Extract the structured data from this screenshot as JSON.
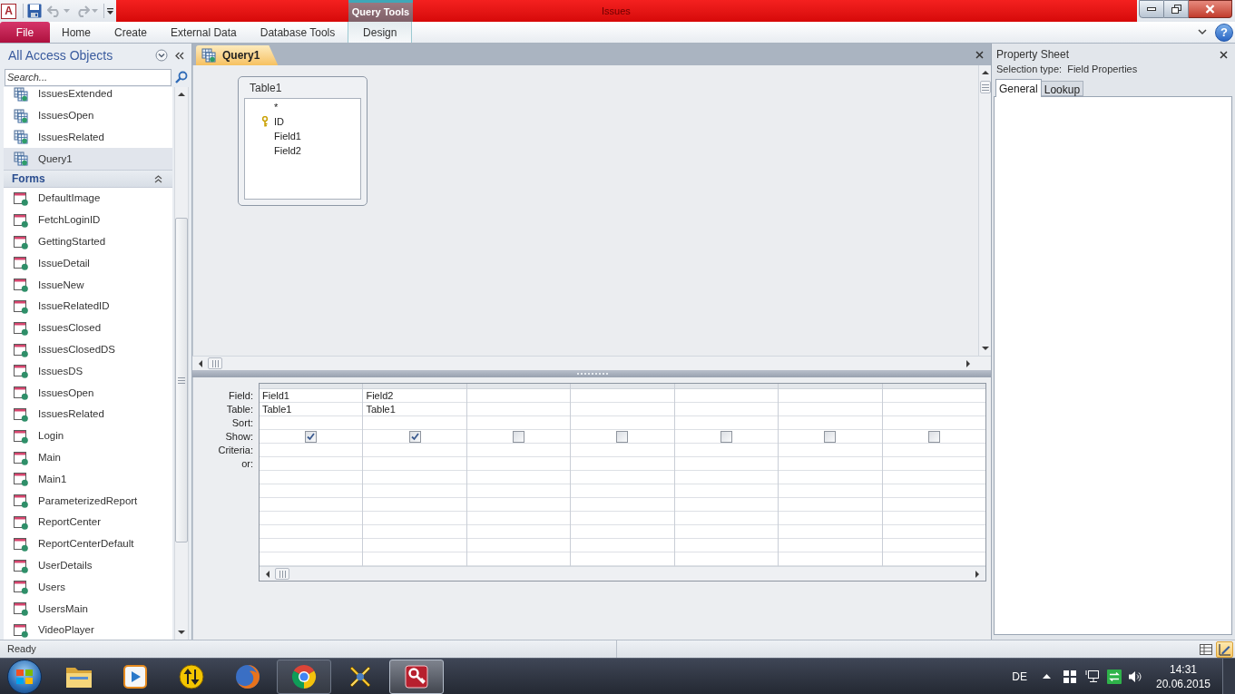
{
  "title_bar": {
    "app_logo": "A",
    "quick_access": [
      {
        "kind": "button",
        "disabled": false
      },
      {
        "kind": "split",
        "disabled": true
      },
      {
        "kind": "split",
        "disabled": true
      }
    ],
    "contextual_group": "Query Tools",
    "title": "Issues"
  },
  "ribbon": {
    "tabs": [
      {
        "label": "File",
        "kind": "file"
      },
      {
        "label": "Home",
        "kind": "tab"
      },
      {
        "label": "Create",
        "kind": "tab"
      },
      {
        "label": "External Data",
        "kind": "tab"
      },
      {
        "label": "Database Tools",
        "kind": "tab"
      },
      {
        "label": "Design",
        "kind": "contextual"
      }
    ],
    "help": "?"
  },
  "nav_pane": {
    "title": "All Access Objects",
    "search": {
      "placeholder": "Search..."
    },
    "sections": [
      {
        "items": [
          {
            "label": "IssuesExtended",
            "kind": "query",
            "selected": false
          },
          {
            "label": "IssuesOpen",
            "kind": "query",
            "selected": false
          },
          {
            "label": "IssuesRelated",
            "kind": "query",
            "selected": false
          },
          {
            "label": "Query1",
            "kind": "query",
            "selected": true
          }
        ]
      },
      {
        "title": "Forms",
        "expanded": true,
        "items": [
          {
            "label": "DefaultImage",
            "kind": "form",
            "selected": false
          },
          {
            "label": "FetchLoginID",
            "kind": "form",
            "selected": false
          },
          {
            "label": "GettingStarted",
            "kind": "form",
            "selected": false
          },
          {
            "label": "IssueDetail",
            "kind": "form",
            "selected": false
          },
          {
            "label": "IssueNew",
            "kind": "form",
            "selected": false
          },
          {
            "label": "IssueRelatedID",
            "kind": "form",
            "selected": false
          },
          {
            "label": "IssuesClosed",
            "kind": "form",
            "selected": false
          },
          {
            "label": "IssuesClosedDS",
            "kind": "form",
            "selected": false
          },
          {
            "label": "IssuesDS",
            "kind": "form",
            "selected": false
          },
          {
            "label": "IssuesOpen",
            "kind": "form",
            "selected": false
          },
          {
            "label": "IssuesRelated",
            "kind": "form",
            "selected": false
          },
          {
            "label": "Login",
            "kind": "form",
            "selected": false
          },
          {
            "label": "Main",
            "kind": "form",
            "selected": false
          },
          {
            "label": "Main1",
            "kind": "form",
            "selected": false
          },
          {
            "label": "ParameterizedReport",
            "kind": "form",
            "selected": false
          },
          {
            "label": "ReportCenter",
            "kind": "form",
            "selected": false
          },
          {
            "label": "ReportCenterDefault",
            "kind": "form",
            "selected": false
          },
          {
            "label": "UserDetails",
            "kind": "form",
            "selected": false
          },
          {
            "label": "Users",
            "kind": "form",
            "selected": false
          },
          {
            "label": "UsersMain",
            "kind": "form",
            "selected": false
          },
          {
            "label": "VideoPlayer",
            "kind": "form",
            "selected": false
          }
        ]
      }
    ]
  },
  "document": {
    "tabs": [
      {
        "label": "Query1",
        "selected": true
      }
    ],
    "table": {
      "title": "Table1",
      "fields": [
        {
          "name": "*",
          "primary_key": false
        },
        {
          "name": "ID",
          "primary_key": true
        },
        {
          "name": "Field1",
          "primary_key": false
        },
        {
          "name": "Field2",
          "primary_key": false
        }
      ]
    },
    "design_grid": {
      "row_labels": [
        "Field:",
        "Table:",
        "Sort:",
        "Show:",
        "Criteria:",
        "or:"
      ],
      "columns": [
        {
          "field": "Field1",
          "table": "Table1",
          "show_checked": true
        },
        {
          "field": "Field2",
          "table": "Table1",
          "show_checked": true
        },
        {
          "show_checked": false
        },
        {
          "show_checked": false
        },
        {
          "show_checked": false
        },
        {
          "show_checked": false
        },
        {
          "show_checked": false
        }
      ]
    }
  },
  "property_sheet": {
    "title": "Property Sheet",
    "selection_label": "Selection type:",
    "selection_value": "Field Properties",
    "tabs": [
      {
        "label": "General",
        "selected": true
      },
      {
        "label": "Lookup",
        "selected": false
      }
    ]
  },
  "status_bar": {
    "text": "Ready",
    "views": [
      {
        "selected": false
      },
      {
        "selected": true
      }
    ]
  },
  "taskbar": {
    "apps": [
      {
        "running": false,
        "selected": false
      },
      {
        "running": false,
        "selected": false
      },
      {
        "running": false,
        "selected": false
      },
      {
        "running": false,
        "selected": false
      },
      {
        "running": true,
        "selected": false
      },
      {
        "running": false,
        "selected": false
      },
      {
        "running": true,
        "selected": true
      }
    ],
    "language": "DE",
    "time": "14:31",
    "date": "20.06.2015"
  }
}
